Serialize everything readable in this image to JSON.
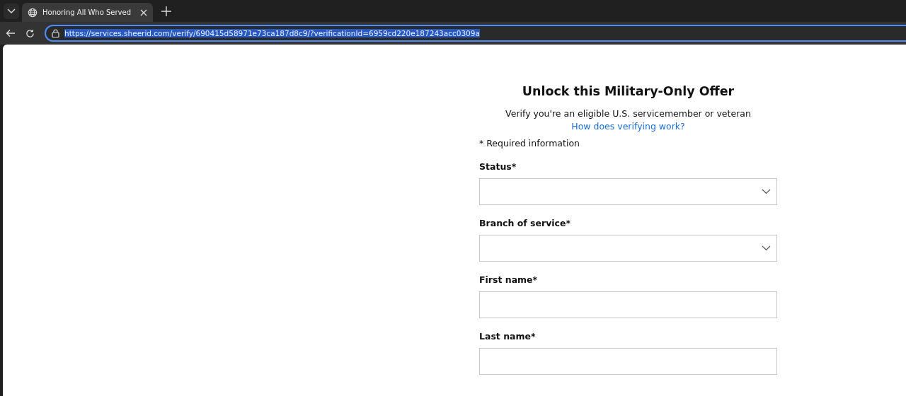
{
  "browser": {
    "tabs": [
      {
        "title": "Honoring All Who Served",
        "selected": true
      }
    ],
    "url": "https://services.sheerid.com/verify/690415d58971e73ca187d8c9/?verificationId=6959cd220e187243acc0309a",
    "url_selected": true
  },
  "form": {
    "title": "Unlock this Military-Only Offer",
    "subtitle": "Verify you're an eligible U.S. servicemember or veteran",
    "help_link": "How does verifying work?",
    "required_note": "* Required information",
    "fields": [
      {
        "label": "Status*",
        "kind": "select"
      },
      {
        "label": "Branch of service*",
        "kind": "select"
      },
      {
        "label": "First name*",
        "kind": "text"
      },
      {
        "label": "Last name*",
        "kind": "text"
      }
    ]
  }
}
